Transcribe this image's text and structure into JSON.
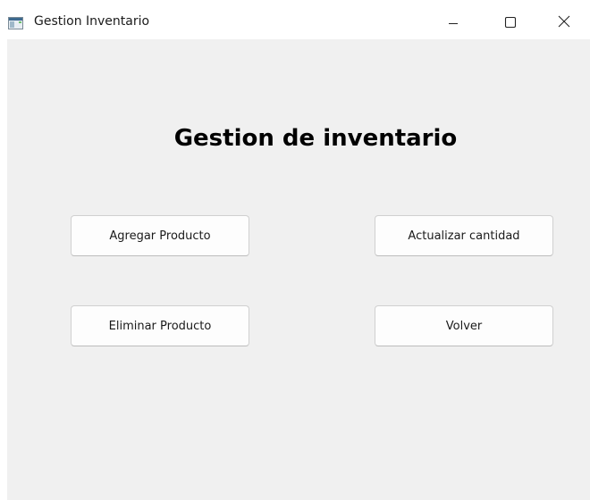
{
  "window": {
    "title": "Gestion Inventario",
    "icon": "app-window-icon",
    "controls": {
      "minimize_icon": "minimize-icon",
      "maximize_icon": "maximize-icon",
      "close_icon": "close-icon"
    }
  },
  "main": {
    "heading": "Gestion de inventario",
    "buttons": {
      "add_product": "Agregar Producto",
      "update_quantity": "Actualizar cantidad",
      "delete_product": "Eliminar Producto",
      "back": "Volver"
    }
  },
  "colors": {
    "background": "#f0f0f0",
    "titlebar": "#ffffff",
    "button_face": "#fdfdfd",
    "button_border": "#d0d0d0"
  }
}
